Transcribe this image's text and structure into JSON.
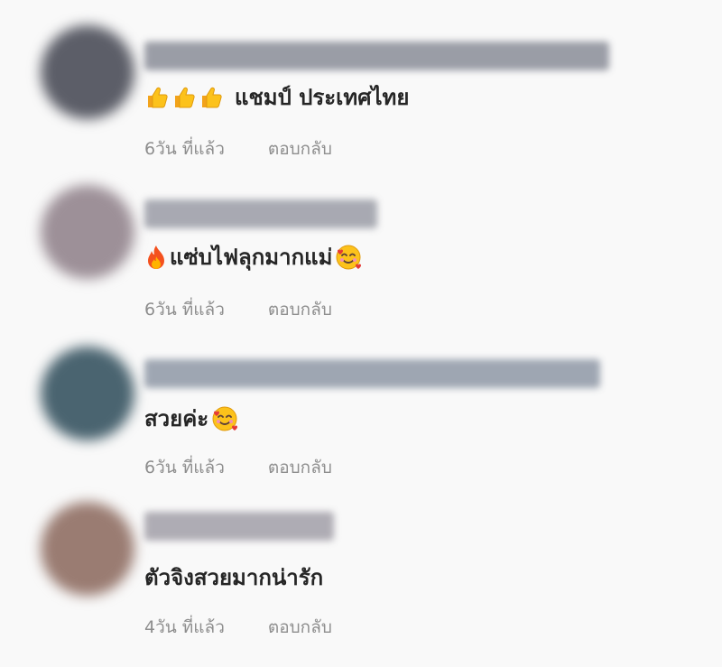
{
  "comments": [
    {
      "avatar_color": "#5c5e68",
      "username_color": "#8a8d98",
      "body": "แชมป์ ประเทศไทย",
      "emoji_prefix": [
        "thumbs-up-icon",
        "thumbs-up-icon",
        "thumbs-up-icon"
      ],
      "emoji_suffix": [],
      "time": "6วัน ที่แล้ว",
      "reply": "ตอบกลับ"
    },
    {
      "avatar_color": "#9d9098",
      "username_color": "#9a9ca6",
      "body": "แซ่บไฟลุกมากแม่",
      "emoji_prefix": [
        "fire-icon"
      ],
      "emoji_suffix": [
        "smiling-face-with-hearts-icon"
      ],
      "time": "6วัน ที่แล้ว",
      "reply": "ตอบกลับ"
    },
    {
      "avatar_color": "#4a6470",
      "username_color": "#8f98a6",
      "body": "สวยค่ะ",
      "emoji_prefix": [],
      "emoji_suffix": [
        "smiling-face-with-hearts-icon"
      ],
      "time": "6วัน ที่แล้ว",
      "reply": "ตอบกลับ"
    },
    {
      "avatar_color": "#9a7c72",
      "username_color": "#a29fa8",
      "body": "ตัวจิงสวยมากน่ารัก",
      "emoji_prefix": [],
      "emoji_suffix": [],
      "time": "4วัน ที่แล้ว",
      "reply": "ตอบกลับ"
    }
  ]
}
